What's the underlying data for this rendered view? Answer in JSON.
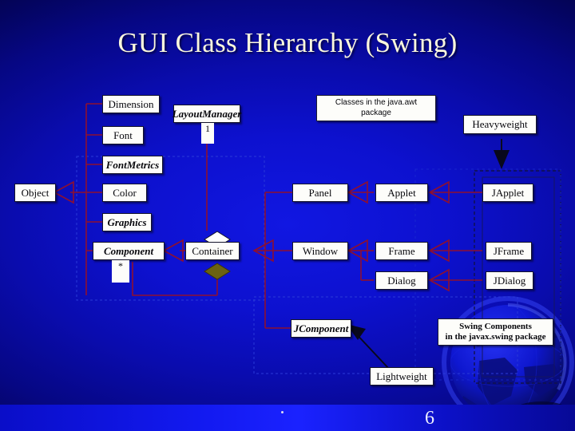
{
  "slide": {
    "title": "GUI Class Hierarchy (Swing)",
    "page_number": "6",
    "footer_bullet": "·",
    "background_color": "#0d11cf",
    "line_color": "#8e1030",
    "box_fill": "#fdfdfa",
    "title_color": "#fbf8dd"
  },
  "nodes": {
    "object": {
      "label": "Object",
      "style": "plain"
    },
    "dimension": {
      "label": "Dimension",
      "style": "plain"
    },
    "font": {
      "label": "Font",
      "style": "plain"
    },
    "fontmetrics": {
      "label": "FontMetrics",
      "style": "italic"
    },
    "color": {
      "label": "Color",
      "style": "plain"
    },
    "graphics": {
      "label": "Graphics",
      "style": "italic"
    },
    "component": {
      "label": "Component",
      "style": "italic"
    },
    "container": {
      "label": "Container",
      "style": "plain"
    },
    "layoutmanager": {
      "label": "LayoutManager",
      "style": "italic"
    },
    "panel": {
      "label": "Panel",
      "style": "plain"
    },
    "applet": {
      "label": "Applet",
      "style": "plain"
    },
    "japplet": {
      "label": "JApplet",
      "style": "plain"
    },
    "window": {
      "label": "Window",
      "style": "plain"
    },
    "frame": {
      "label": "Frame",
      "style": "plain"
    },
    "jframe": {
      "label": "JFrame",
      "style": "plain"
    },
    "dialog": {
      "label": "Dialog",
      "style": "plain"
    },
    "jdialog": {
      "label": "JDialog",
      "style": "plain"
    },
    "jcomponent": {
      "label": "JComponent",
      "style": "italic"
    },
    "heavyweight": {
      "label": "Heavyweight",
      "style": "plain"
    },
    "lightweight": {
      "label": "Lightweight",
      "style": "plain"
    }
  },
  "multiplicities": {
    "layoutmanager_to_container": "1",
    "container_to_component": "*"
  },
  "notes": {
    "awt": {
      "line1": "Classes in the java.awt",
      "line2": "package"
    },
    "swing": {
      "line1": "Swing Components",
      "line2": "in the javax.swing package"
    }
  }
}
